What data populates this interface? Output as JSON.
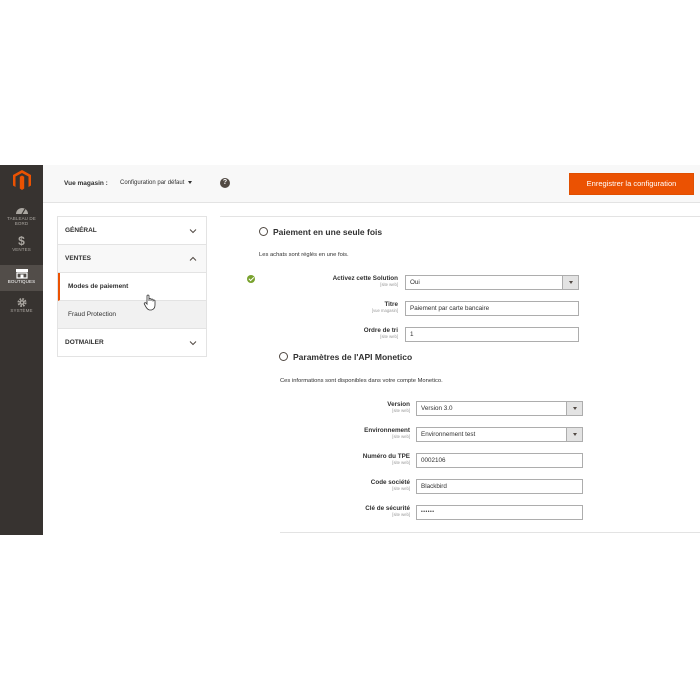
{
  "nav": {
    "items": [
      {
        "label": "TABLEAU DE BORD",
        "icon": "dashboard-icon"
      },
      {
        "label": "VENTES",
        "icon": "dollar-icon"
      },
      {
        "label": "BOUTIQUES",
        "icon": "store-icon"
      },
      {
        "label": "SYSTÈME",
        "icon": "gear-icon"
      }
    ]
  },
  "header": {
    "store_label": "Vue magasin :",
    "store_value": "Configuration par défaut",
    "help_glyph": "?",
    "save_label": "Enregistrer la configuration"
  },
  "tabs": {
    "general": "GÉNÉRAL",
    "ventes": "VENTES",
    "ventes_items": [
      "Modes de paiement",
      "Fraud Protection"
    ],
    "dotmailer": "DOTMAILER"
  },
  "section1": {
    "title": "Paiement en une seule fois",
    "note": "Les achats sont réglés en une fois.",
    "fields": [
      {
        "label": "Activez cette Solution",
        "scope": "[site web]",
        "value": "Oui",
        "type": "select"
      },
      {
        "label": "Titre",
        "scope": "[vue magasin]",
        "value": "Paiement par carte bancaire",
        "type": "text"
      },
      {
        "label": "Ordre de tri",
        "scope": "[site web]",
        "value": "1",
        "type": "text"
      }
    ]
  },
  "section2": {
    "title": "Paramètres de l'API Monetico",
    "note": "Ces informations sont disponibles dans votre compte Monetico.",
    "fields": [
      {
        "label": "Version",
        "scope": "[site web]",
        "value": "Version 3.0",
        "type": "select"
      },
      {
        "label": "Environnement",
        "scope": "[site web]",
        "value": "Environnement test",
        "type": "select"
      },
      {
        "label": "Numéro du TPE",
        "scope": "[site web]",
        "value": "0002106",
        "type": "text"
      },
      {
        "label": "Code société",
        "scope": "[site web]",
        "value": "Blackbird",
        "type": "text"
      },
      {
        "label": "Clé de sécurité",
        "scope": "[site web]",
        "value": "••••••",
        "type": "password"
      }
    ]
  },
  "colors": {
    "accent": "#eb5202",
    "nav_bg": "#373330",
    "success": "#79a22e"
  }
}
